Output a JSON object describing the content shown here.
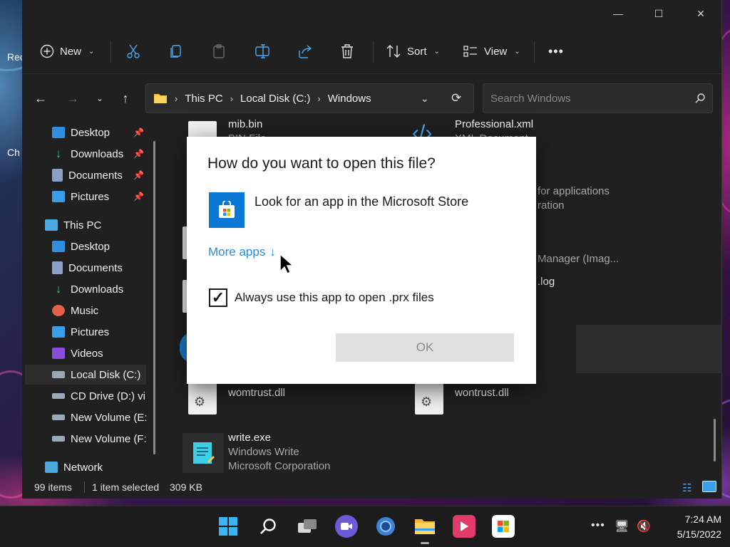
{
  "desktop": {
    "icon_labels": [
      "Rec",
      "Ch"
    ]
  },
  "window": {
    "controls": {
      "minimize": "—",
      "maximize": "☐",
      "close": "✕"
    }
  },
  "toolbar": {
    "new_label": "New",
    "sort_label": "Sort",
    "view_label": "View",
    "more_label": "•••"
  },
  "address": {
    "crumbs": [
      "This PC",
      "Local Disk (C:)",
      "Windows"
    ],
    "search_placeholder": "Search Windows"
  },
  "sidebar": {
    "quick_access": [
      {
        "label": "Desktop",
        "icon": "desktop-icon",
        "color": "#2f8fe0"
      },
      {
        "label": "Downloads",
        "icon": "download-icon",
        "color": "#30c46a"
      },
      {
        "label": "Documents",
        "icon": "documents-icon",
        "color": "#8aa0c8"
      },
      {
        "label": "Pictures",
        "icon": "pictures-icon",
        "color": "#3a9ee8"
      }
    ],
    "this_pc_label": "This PC",
    "this_pc_items": [
      {
        "label": "Desktop",
        "icon": "desktop-icon",
        "color": "#2f8fe0"
      },
      {
        "label": "Documents",
        "icon": "documents-icon",
        "color": "#8aa0c8"
      },
      {
        "label": "Downloads",
        "icon": "download-icon",
        "color": "#30c46a"
      },
      {
        "label": "Music",
        "icon": "music-icon",
        "color": "#e0604a"
      },
      {
        "label": "Pictures",
        "icon": "pictures-icon",
        "color": "#3a9ee8"
      },
      {
        "label": "Videos",
        "icon": "videos-icon",
        "color": "#8a4fd8"
      },
      {
        "label": "Local Disk (C:)",
        "icon": "drive-icon",
        "color": "#9aa8b8"
      },
      {
        "label": "CD Drive (D:) vi",
        "icon": "drive-icon",
        "color": "#9aa8b8"
      },
      {
        "label": "New Volume (E:",
        "icon": "drive-icon",
        "color": "#9aa8b8"
      },
      {
        "label": "New Volume (F:",
        "icon": "drive-icon",
        "color": "#9aa8b8"
      }
    ],
    "network_label": "Network"
  },
  "files": {
    "mib_name": "mib.bin",
    "mib_type": "BIN File",
    "professional_name": "Professional.xml",
    "professional_type": "XML Document",
    "partial_1a": "for applications",
    "partial_1b": "ration",
    "partial_2": "Manager (Imag...",
    "partial_3": ".log",
    "womtrust_name": "womtrust.dll",
    "wontrust_name": "wontrust.dll",
    "write_name": "write.exe",
    "write_desc": "Windows Write",
    "write_company": "Microsoft Corporation"
  },
  "status": {
    "item_count": "99 items",
    "selected": "1 item selected",
    "size": "309 KB"
  },
  "dialog": {
    "title": "How do you want to open this file?",
    "store_option": "Look for an app in the Microsoft Store",
    "more_apps": "More apps",
    "always_use": "Always use this app to open .prx files",
    "always_use_checked": true,
    "ok_label": "OK"
  },
  "taskbar": {
    "time": "7:24 AM",
    "date": "5/15/2022",
    "tray_more": "•••"
  }
}
